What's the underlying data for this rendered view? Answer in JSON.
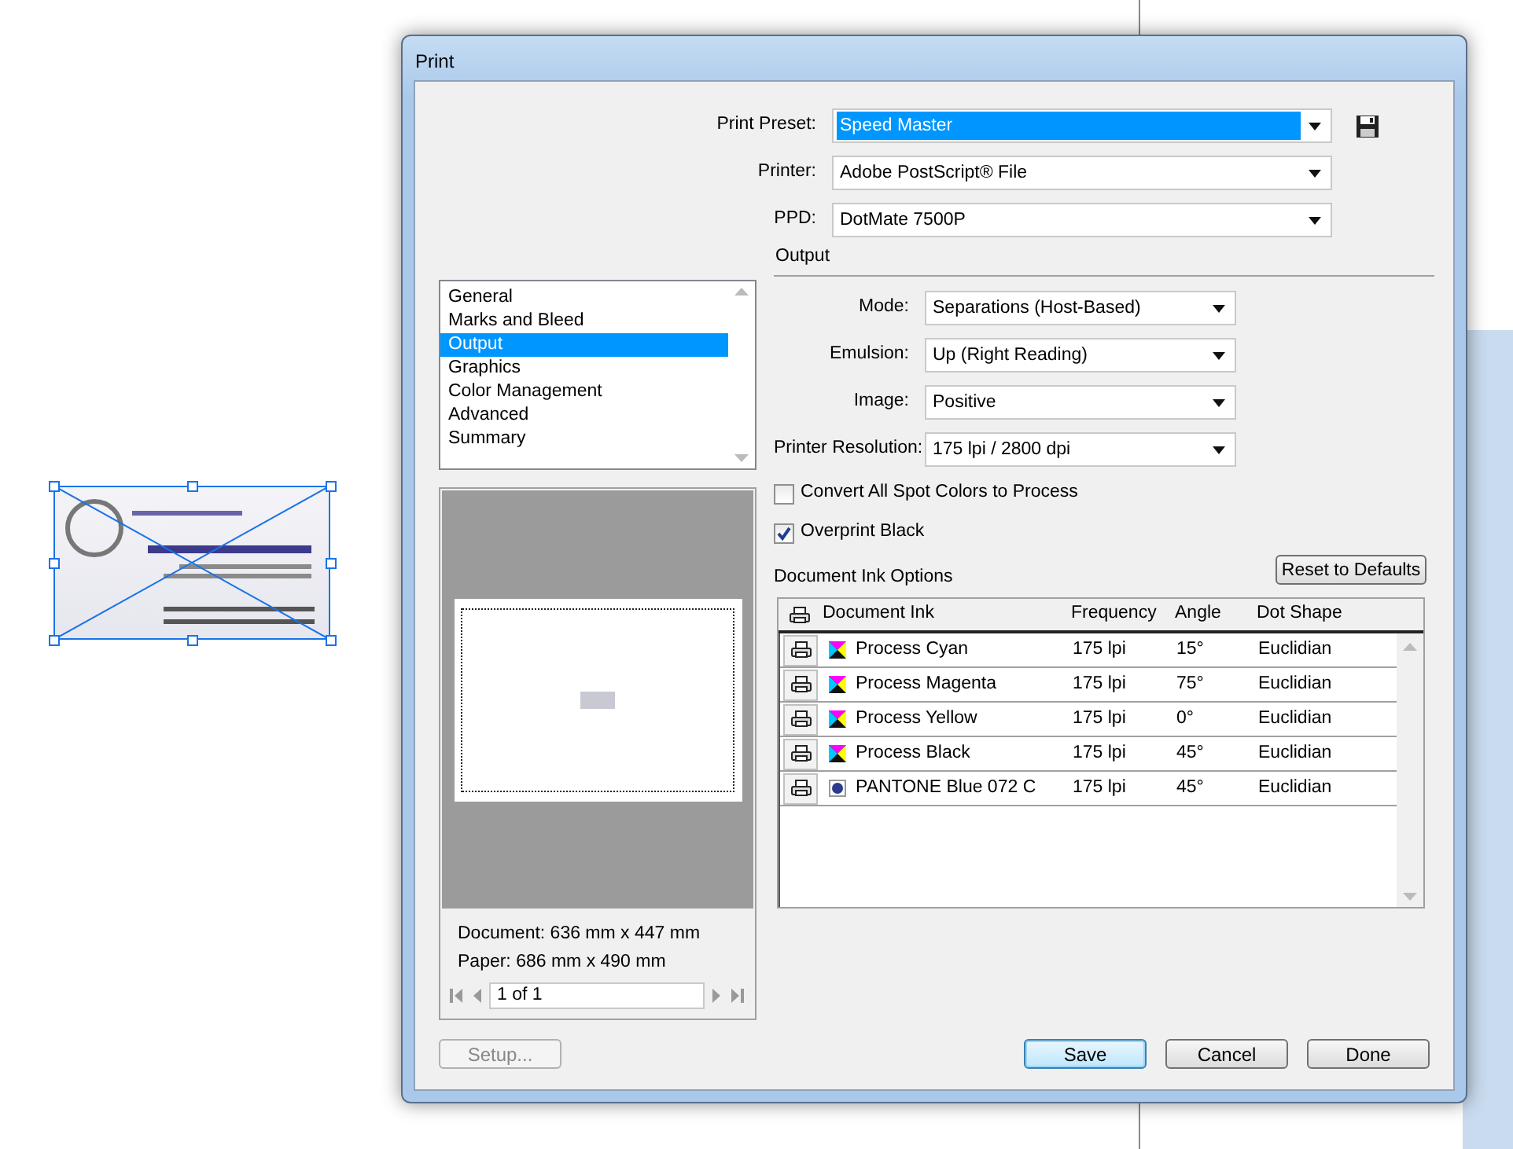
{
  "window": {
    "title": "Print"
  },
  "preset_fields": [
    {
      "label": "Print Preset:",
      "value": "Speed Master",
      "highlighted": true
    },
    {
      "label": "Printer:",
      "value": "Adobe PostScript® File",
      "highlighted": false
    },
    {
      "label": "PPD:",
      "value": "DotMate 7500P",
      "highlighted": false
    }
  ],
  "section_title": "Output",
  "categories": [
    {
      "label": "General",
      "selected": false
    },
    {
      "label": "Marks and Bleed",
      "selected": false
    },
    {
      "label": "Output",
      "selected": true
    },
    {
      "label": "Graphics",
      "selected": false
    },
    {
      "label": "Color Management",
      "selected": false
    },
    {
      "label": "Advanced",
      "selected": false
    },
    {
      "label": "Summary",
      "selected": false
    }
  ],
  "output_fields": [
    {
      "label": "Mode:",
      "value": "Separations (Host-Based)"
    },
    {
      "label": "Emulsion:",
      "value": "Up (Right Reading)"
    },
    {
      "label": "Image:",
      "value": "Positive"
    },
    {
      "label": "Printer Resolution:",
      "value": "175 lpi / 2800 dpi"
    }
  ],
  "checkboxes": [
    {
      "label": "Convert All Spot Colors to Process",
      "checked": false
    },
    {
      "label": "Overprint Black",
      "checked": true
    }
  ],
  "ink_options": {
    "title": "Document Ink Options",
    "reset_button": "Reset to Defaults",
    "columns": [
      "Document Ink",
      "Frequency",
      "Angle",
      "Dot Shape"
    ],
    "rows": [
      {
        "kind": "process",
        "name": "Process Cyan",
        "frequency": "175 lpi",
        "angle": "15°",
        "dot_shape": "Euclidian"
      },
      {
        "kind": "process",
        "name": "Process Magenta",
        "frequency": "175 lpi",
        "angle": "75°",
        "dot_shape": "Euclidian"
      },
      {
        "kind": "process",
        "name": "Process Yellow",
        "frequency": "175 lpi",
        "angle": "0°",
        "dot_shape": "Euclidian"
      },
      {
        "kind": "process",
        "name": "Process Black",
        "frequency": "175 lpi",
        "angle": "45°",
        "dot_shape": "Euclidian"
      },
      {
        "kind": "spot",
        "color": "#2b3a8c",
        "name": "PANTONE Blue 072 C",
        "frequency": "175 lpi",
        "angle": "45°",
        "dot_shape": "Euclidian"
      }
    ]
  },
  "preview": {
    "document": "Document: 636 mm x 447 mm",
    "paper": "Paper: 686 mm x 490 mm",
    "page_field": "1 of 1"
  },
  "setup_button": {
    "label": "Setup...",
    "disabled": true
  },
  "buttons": [
    {
      "label": "Save",
      "default": true
    },
    {
      "label": "Cancel",
      "default": false
    },
    {
      "label": "Done",
      "default": false
    }
  ]
}
